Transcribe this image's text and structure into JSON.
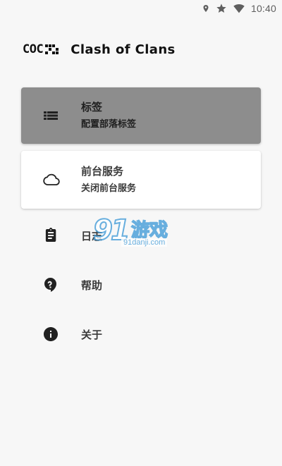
{
  "status_bar": {
    "time": "10:40",
    "icons": [
      "location-icon",
      "star-icon",
      "wifi-icon"
    ]
  },
  "header": {
    "logo_text": "COC",
    "app_title": "Clash of Clans"
  },
  "menu": {
    "tags": {
      "icon": "list-icon",
      "title": "标签",
      "subtitle": "配置部落标签"
    },
    "foreground_service": {
      "icon": "cloud-icon",
      "title": "前台服务",
      "subtitle": "关闭前台服务"
    },
    "items": [
      {
        "icon": "clipboard-icon",
        "label": "日志"
      },
      {
        "icon": "help-icon",
        "label": "帮助"
      },
      {
        "icon": "info-icon",
        "label": "关于"
      }
    ]
  },
  "watermark": {
    "number": "91",
    "brand": "游戏",
    "url": "91danji.com"
  },
  "colors": {
    "background": "#f7f7f7",
    "selected_card": "#8d8d8d",
    "card": "#ffffff",
    "icon": "#212121",
    "watermark_blue": "#3f9ad8"
  }
}
